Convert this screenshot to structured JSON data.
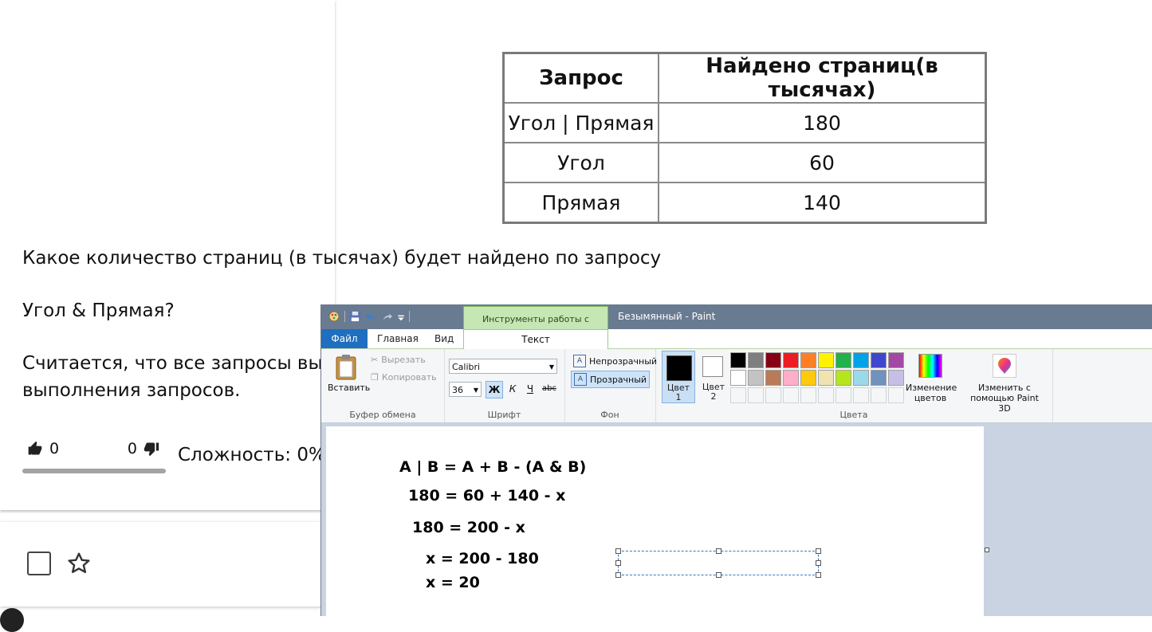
{
  "table": {
    "headers": [
      "Запрос",
      "Найдено страниц(в тысячах)"
    ],
    "rows": [
      [
        "Угол | Прямая",
        "180"
      ],
      [
        "Угол",
        "60"
      ],
      [
        "Прямая",
        "140"
      ]
    ]
  },
  "question": {
    "line1": "Какое количество страниц (в тысячах) будет найдено по запросу",
    "line2": "Угол & Прямая?",
    "line3": "Считается, что все запросы вып",
    "line4": "выполнения запросов."
  },
  "votes": {
    "likes": "0",
    "dislikes": "0",
    "difficulty": "Сложность: 0%"
  },
  "paint": {
    "context_tab": "Инструменты работы с текстом",
    "window_title": "Безымянный - Paint",
    "tabs": {
      "file": "Файл",
      "home": "Главная",
      "view": "Вид",
      "text": "Текст"
    },
    "clipboard": {
      "paste": "Вставить",
      "cut": "Вырезать",
      "copy": "Копировать",
      "group": "Буфер обмена"
    },
    "font": {
      "name": "Calibri",
      "size": "36",
      "bold": "Ж",
      "italic": "К",
      "underline": "Ч",
      "strike": "abc",
      "group": "Шрифт"
    },
    "background": {
      "opaque": "Непрозрачный",
      "transparent": "Прозрачный",
      "group": "Фон"
    },
    "colors": {
      "color1_a": "Цвет",
      "color1_b": "1",
      "color2_a": "Цвет",
      "color2_b": "2",
      "edit_a": "Изменение",
      "edit_b": "цветов",
      "p3d_a": "Изменить с",
      "p3d_b": "помощью Paint 3D",
      "group": "Цвета",
      "palette": [
        "#000000",
        "#7f7f7f",
        "#880015",
        "#ed1c24",
        "#ff7f27",
        "#fff200",
        "#22b14c",
        "#00a2e8",
        "#3f48cc",
        "#a349a4",
        "#ffffff",
        "#c3c3c3",
        "#b97a57",
        "#ffaec9",
        "#ffc90e",
        "#efe4b0",
        "#b5e61d",
        "#99d9ea",
        "#7092be",
        "#c8bfe7"
      ]
    },
    "canvas_lines": [
      "A | B = A + B - (A & B)",
      "180 = 60 + 140 - x",
      "180 = 200 - x",
      "x = 200 - 180",
      "x = 20"
    ]
  }
}
